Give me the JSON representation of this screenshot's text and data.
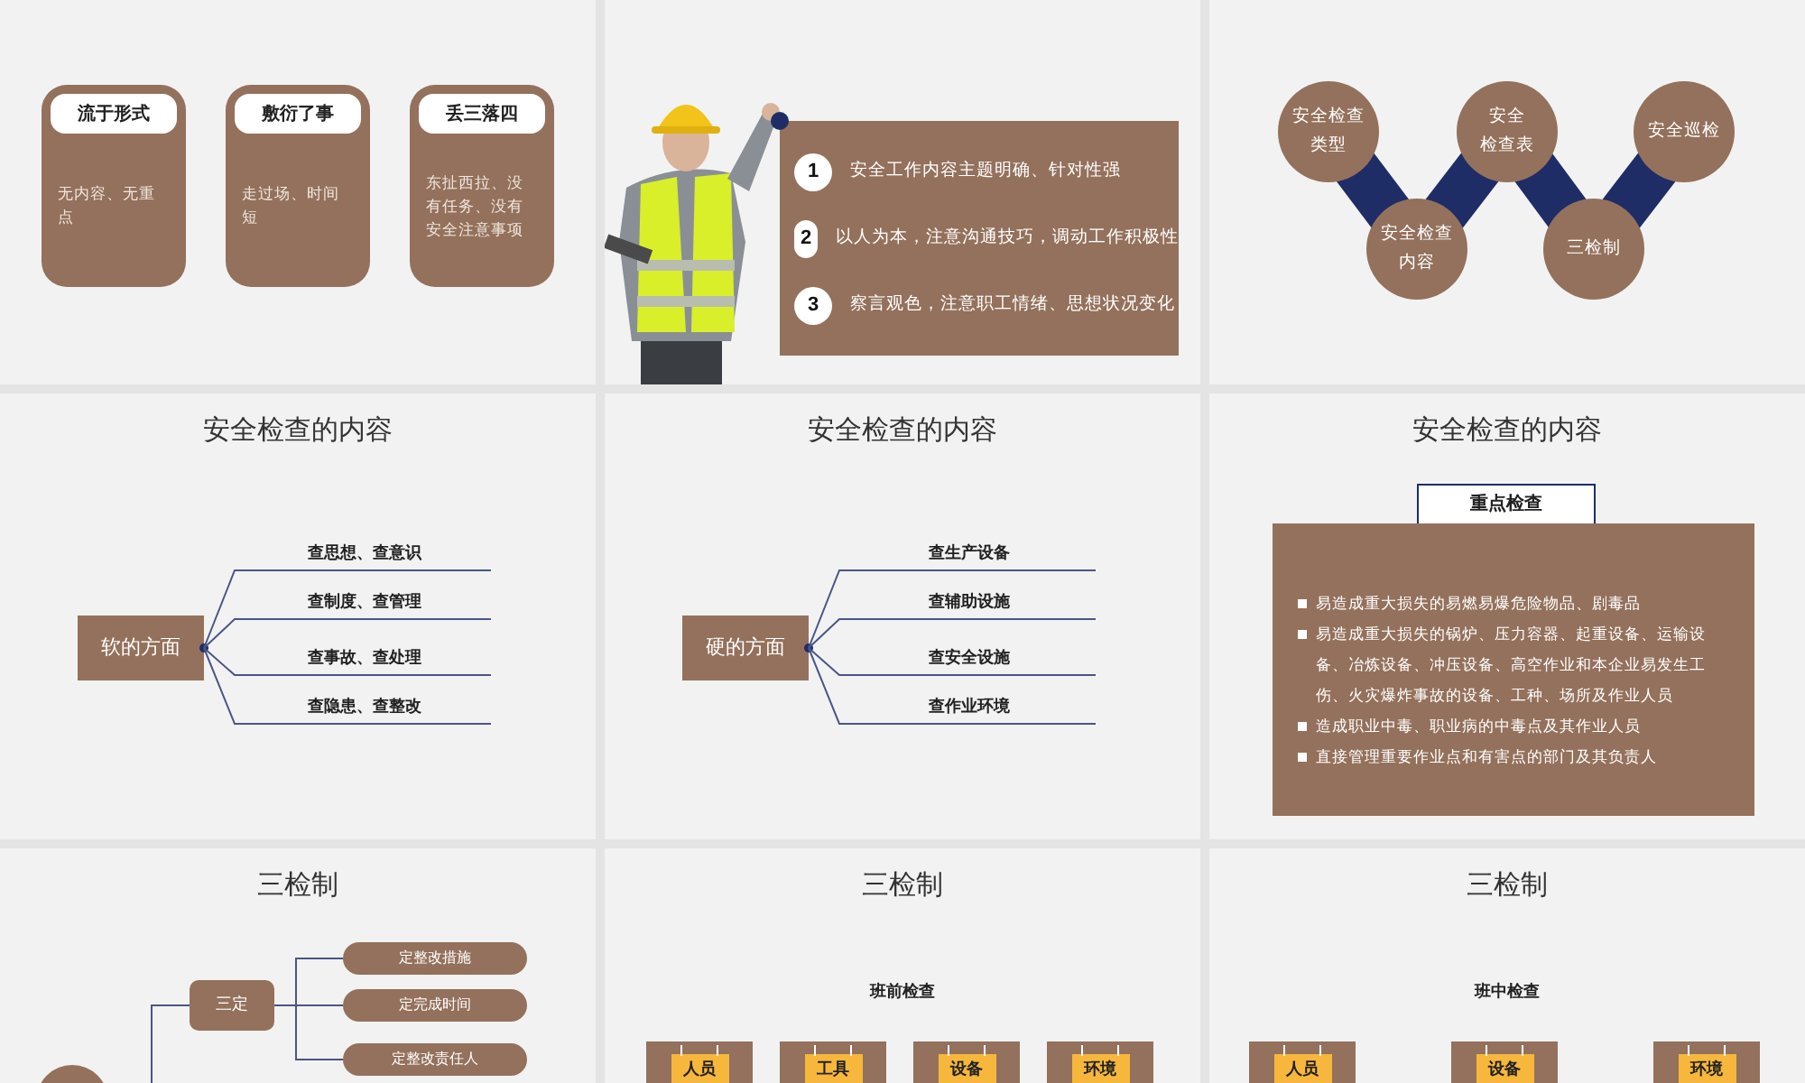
{
  "slides": [
    {
      "kind": "cards",
      "cards": [
        {
          "title": "流于形式",
          "text": "无内容、无重点"
        },
        {
          "title": "敷衍了事",
          "text": "走过场、时间短"
        },
        {
          "title": "丢三落四",
          "text": "东扯西拉、没有任务、没有安全注意事项"
        }
      ]
    },
    {
      "kind": "steps",
      "steps": [
        {
          "number": "1",
          "text": "安全工作内容主题明确、针对性强"
        },
        {
          "number": "2",
          "text": "以人为本，注意沟通技巧，调动工作积极性"
        },
        {
          "number": "3",
          "text": "察言观色，注意职工情绪、思想状况变化"
        }
      ]
    },
    {
      "kind": "flow",
      "nodes": [
        {
          "lines": [
            "安全检查",
            "类型"
          ]
        },
        {
          "lines": [
            "安全检查",
            "内容"
          ]
        },
        {
          "lines": [
            "安全",
            "检查表"
          ]
        },
        {
          "lines": [
            "三检制"
          ]
        },
        {
          "lines": [
            "安全巡检"
          ]
        }
      ]
    },
    {
      "kind": "mindmap",
      "title": "安全检查的内容",
      "root": "软的方面",
      "branches": [
        "查思想、查意识",
        "查制度、查管理",
        "查事故、查处理",
        "查隐患、查整改"
      ]
    },
    {
      "kind": "mindmap",
      "title": "安全检查的内容",
      "root": "硬的方面",
      "branches": [
        "查生产设备",
        "查辅助设施",
        "查安全设施",
        "查作业环境"
      ]
    },
    {
      "kind": "focus",
      "title": "安全检查的内容",
      "heading": "重点检查",
      "bullets": [
        "易造成重大损失的易燃易爆危险物品、剧毒品",
        "易造成重大损失的锅炉、压力容器、起重设备、运输设备、冶炼设备、冲压设备、高空作业和本企业易发生工伤、火灾爆炸事故的设备、工种、场所及作业人员",
        "造成职业中毒、职业病的中毒点及其作业人员",
        "直接管理重要作业点和有害点的部门及其负责人"
      ]
    },
    {
      "kind": "tree",
      "title": "三检制",
      "node": "三定",
      "leaves": [
        "定整改措施",
        "定完成时间",
        "定整改责任人"
      ]
    },
    {
      "kind": "boxes",
      "title": "三检制",
      "subtitle": "班前检查",
      "items": [
        "人员",
        "工具",
        "设备",
        "环境"
      ]
    },
    {
      "kind": "boxes",
      "title": "三检制",
      "subtitle": "班中检查",
      "items": [
        "人员",
        "设备",
        "环境"
      ]
    }
  ]
}
